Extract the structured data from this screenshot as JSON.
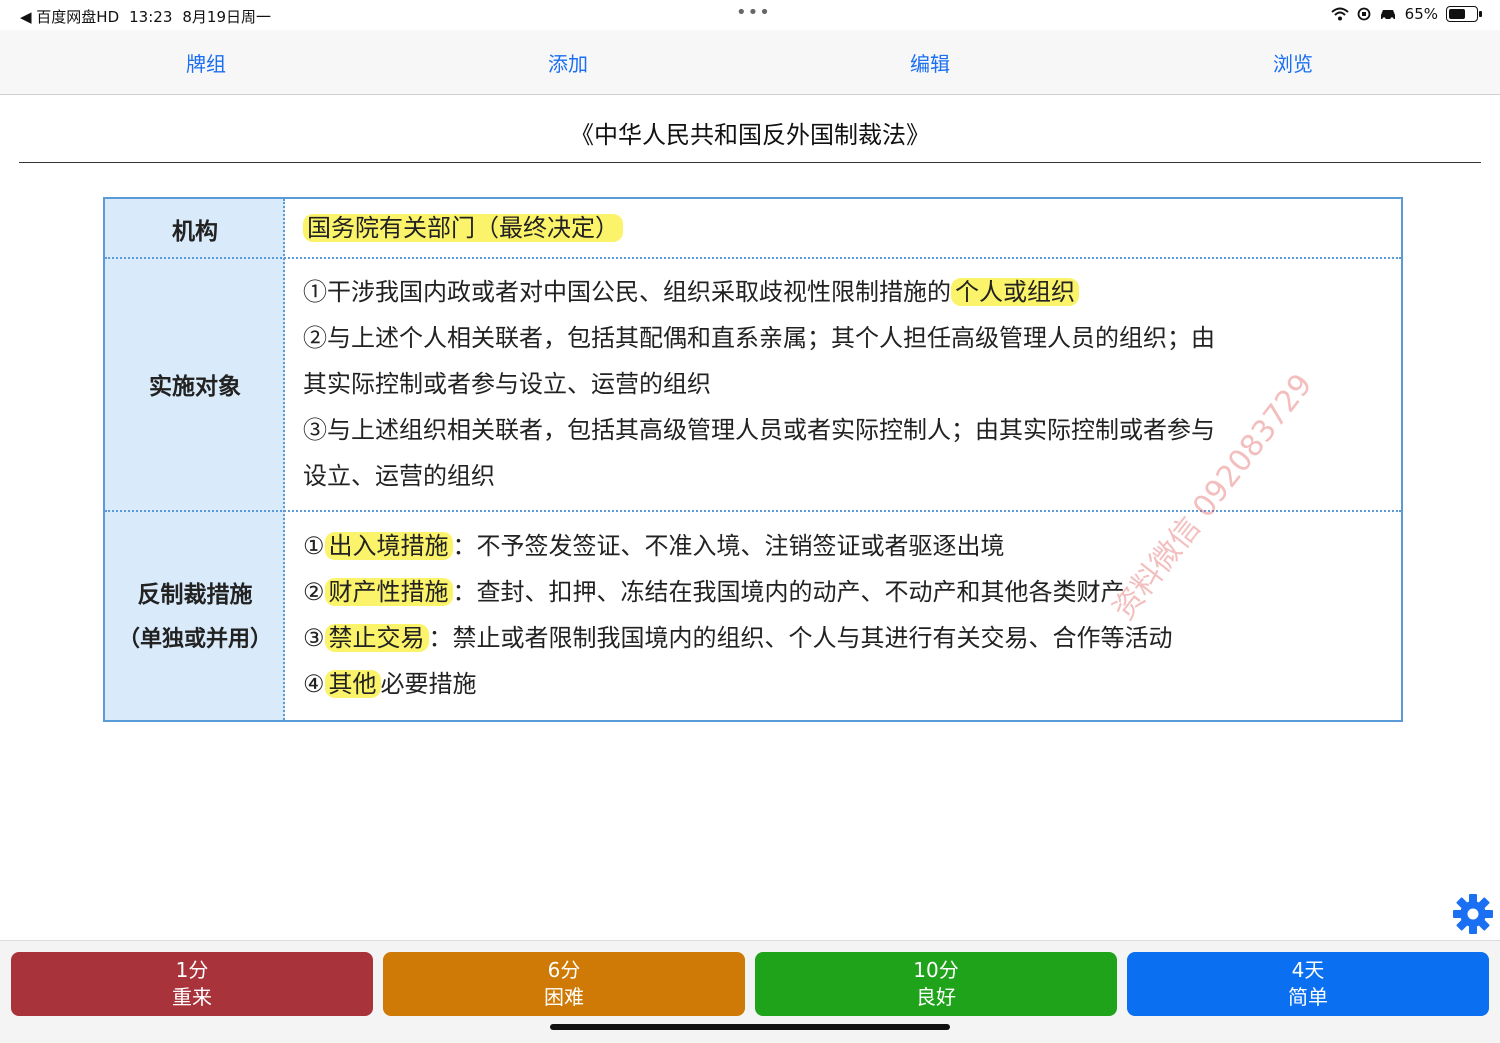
{
  "status_bar": {
    "back_app": "◀ 百度网盘HD",
    "time": "13:23",
    "date": "8月19日周一",
    "dots": "•••",
    "battery_text": "65%",
    "battery_level": 0.65
  },
  "nav": {
    "items": [
      {
        "label": "牌组"
      },
      {
        "label": "添加"
      },
      {
        "label": "编辑"
      },
      {
        "label": "浏览"
      }
    ]
  },
  "card": {
    "title": "《中华人民共和国反外国制裁法》",
    "rows": [
      {
        "label": "机构",
        "lines": [
          [
            {
              "text": "国务院有关部门（最终决定）",
              "hl": true
            }
          ]
        ]
      },
      {
        "label": "实施对象",
        "lines": [
          [
            {
              "text": "①干涉我国内政或者对中国公民、组织采取歧视性限制措施的",
              "hl": false
            },
            {
              "text": "个人或组织",
              "hl": true
            }
          ],
          [
            {
              "text": "②与上述个人相关联者，包括其配偶和直系亲属；其个人担任高级管理人员的组织；由",
              "hl": false
            }
          ],
          [
            {
              "text": "其实际控制或者参与设立、运营的组织",
              "hl": false
            }
          ],
          [
            {
              "text": "③与上述组织相关联者，包括其高级管理人员或者实际控制人；由其实际控制或者参与",
              "hl": false
            }
          ],
          [
            {
              "text": "设立、运营的组织",
              "hl": false
            }
          ]
        ]
      },
      {
        "label": "反制裁措施",
        "sublabel": "（单独或并用）",
        "lines": [
          [
            {
              "text": "①",
              "hl": false
            },
            {
              "text": "出入境措施",
              "hl": true
            },
            {
              "text": "：不予签发签证、不准入境、注销签证或者驱逐出境",
              "hl": false
            }
          ],
          [
            {
              "text": "②",
              "hl": false
            },
            {
              "text": "财产性措施",
              "hl": true
            },
            {
              "text": "：查封、扣押、冻结在我国境内的动产、不动产和其他各类财产",
              "hl": false
            }
          ],
          [
            {
              "text": "③",
              "hl": false
            },
            {
              "text": "禁止交易",
              "hl": true
            },
            {
              "text": "：禁止或者限制我国境内的组织、个人与其进行有关交易、合作等活动",
              "hl": false
            }
          ],
          [
            {
              "text": "④",
              "hl": false
            },
            {
              "text": "其他",
              "hl": true
            },
            {
              "text": "必要措施",
              "hl": false
            }
          ]
        ]
      }
    ],
    "watermark": "资料微信 092083729"
  },
  "answer_buttons": [
    {
      "interval": "1分",
      "label": "重来",
      "color": "#a8333b"
    },
    {
      "interval": "6分",
      "label": "困难",
      "color": "#cf7a06"
    },
    {
      "interval": "10分",
      "label": "良好",
      "color": "#1fa31a"
    },
    {
      "interval": "4天",
      "label": "简单",
      "color": "#0a6ff0"
    }
  ],
  "colors": {
    "accent": "#1b6ff2",
    "table_border": "#5a9ad6",
    "label_bg": "#d9ebfa",
    "highlight": "#fbf36a"
  }
}
